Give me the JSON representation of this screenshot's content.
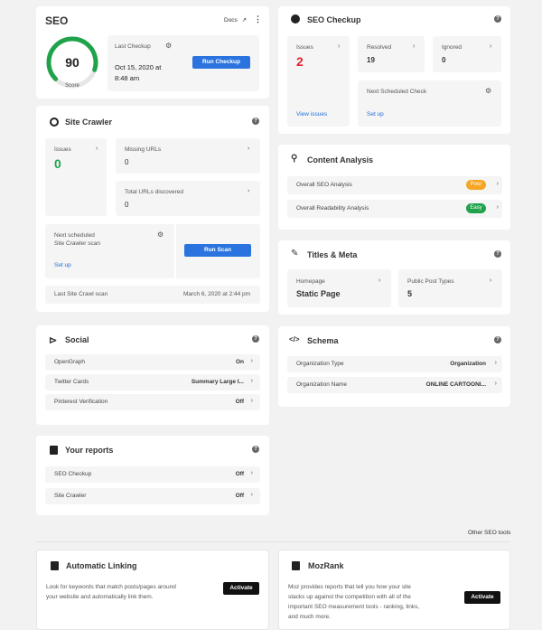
{
  "seo": {
    "title": "SEO",
    "docs_label": "Docs",
    "score": "90",
    "score_label": "Score",
    "last_checkup_label": "Last Checkup",
    "last_checkup_date": "Oct 15, 2020 at",
    "last_checkup_time": "8:48 am",
    "run_checkup_label": "Run Checkup",
    "score_fraction": 0.9
  },
  "crawler": {
    "title": "Site Crawler",
    "issues_label": "Issues",
    "issues_value": "0",
    "missing_label": "Missing URLs",
    "missing_value": "0",
    "total_label": "Total URLs discovered",
    "total_value": "0",
    "next_label_1": "Next scheduled",
    "next_label_2": "Site Crawler scan",
    "setup_label": "Set up",
    "run_scan_label": "Run Scan",
    "last_scan_label": "Last Site Crawl scan",
    "last_scan_value": "March 6, 2020 at 2:44 pm"
  },
  "social": {
    "title": "Social",
    "rows": [
      {
        "label": "OpenGraph",
        "value": "On"
      },
      {
        "label": "Twitter Cards",
        "value": "Summary Large I..."
      },
      {
        "label": "Pinterest Verification",
        "value": "Off"
      }
    ]
  },
  "reports": {
    "title": "Your reports",
    "rows": [
      {
        "label": "SEO Checkup",
        "value": "Off"
      },
      {
        "label": "Site Crawler",
        "value": "Off"
      }
    ]
  },
  "checkup": {
    "title": "SEO Checkup",
    "issues_label": "Issues",
    "issues_value": "2",
    "resolved_label": "Resolved",
    "resolved_value": "19",
    "ignored_label": "Ignored",
    "ignored_value": "0",
    "view_issues_label": "View issues",
    "next_label": "Next Scheduled Check",
    "setup_label": "Set up"
  },
  "content": {
    "title": "Content Analysis",
    "rows": [
      {
        "label": "Overall SEO Analysis",
        "badge": "Poor",
        "color": "#f5a623"
      },
      {
        "label": "Overall Readability Analysis",
        "badge": "Easy",
        "color": "#1fa34a"
      }
    ]
  },
  "titles_meta": {
    "title": "Titles & Meta",
    "homepage_label": "Homepage",
    "homepage_value": "Static Page",
    "post_types_label": "Public Post Types",
    "post_types_value": "5"
  },
  "schema": {
    "title": "Schema",
    "rows": [
      {
        "label": "Organization Type",
        "value": "Organization"
      },
      {
        "label": "Organization Name",
        "value": "ONLINE CARTOONI..."
      }
    ]
  },
  "other_tools_label": "Other SEO tools",
  "linking": {
    "title": "Automatic Linking",
    "desc_1": "Look for keywords that match posts/pages around",
    "desc_2": "your website and automatically link them.",
    "activate_label": "Activate"
  },
  "mozrank": {
    "title": "MozRank",
    "desc_1": "Moz provides reports that tell you how your site",
    "desc_2": "stacks up against the competition with all of the",
    "desc_3": "important SEO measurement tools - ranking, links,",
    "desc_4": "and much more.",
    "activate_label": "Activate"
  },
  "colors": {
    "accent": "#2b74e0",
    "success": "#1fa34a",
    "danger": "#e0232e",
    "warning": "#f5a623"
  }
}
